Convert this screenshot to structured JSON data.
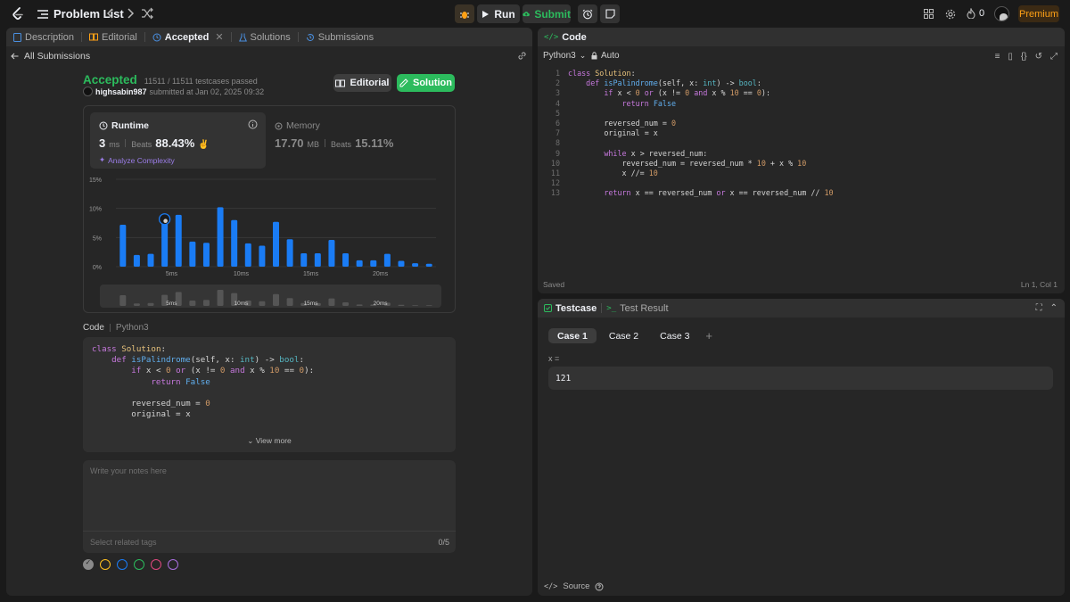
{
  "header": {
    "problem_list": "Problem List",
    "run": "Run",
    "submit": "Submit",
    "streak": "0",
    "premium": "Premium"
  },
  "left_tabs": [
    {
      "label": "Description",
      "icon": "document-icon"
    },
    {
      "label": "Editorial",
      "icon": "book-icon"
    },
    {
      "label": "Accepted",
      "icon": "clock-icon"
    },
    {
      "label": "Solutions",
      "icon": "flask-icon"
    },
    {
      "label": "Submissions",
      "icon": "history-icon"
    }
  ],
  "submission": {
    "back_label": "All Submissions",
    "status": "Accepted",
    "testcases": "11511 / 11511 testcases passed",
    "user": "highsabin987",
    "submitted_at": "submitted at Jan 02, 2025 09:32",
    "editorial_btn": "Editorial",
    "solution_btn": "Solution"
  },
  "runtime": {
    "label": "Runtime",
    "value": "3",
    "unit": "ms",
    "beats_label": "Beats",
    "beats": "88.43%",
    "analyze": "Analyze Complexity"
  },
  "memory": {
    "label": "Memory",
    "value": "17.70",
    "unit": "MB",
    "beats_label": "Beats",
    "beats": "15.11%"
  },
  "chart_data": {
    "type": "bar",
    "yticks": [
      "15%",
      "10%",
      "5%",
      "0%"
    ],
    "xticks": [
      "5ms",
      "10ms",
      "15ms",
      "20ms"
    ],
    "ylim": [
      0,
      15
    ],
    "values": [
      7.2,
      2.0,
      2.2,
      8.0,
      8.9,
      4.3,
      4.1,
      10.2,
      8.0,
      4.0,
      3.6,
      7.7,
      4.7,
      2.3,
      2.3,
      4.6,
      2.3,
      1.1,
      1.1,
      2.2,
      1.0,
      0.6,
      0.5
    ],
    "mini_values": [
      3.0,
      0.7,
      0.8,
      3.1,
      3.9,
      1.5,
      1.7,
      4.5,
      3.6,
      1.5,
      1.3,
      3.3,
      2.2,
      0.8,
      0.8,
      2.1,
      1.0,
      0.4,
      0.4,
      0.9,
      0.3,
      0.2,
      0.2
    ],
    "highlight_index": 3,
    "grid": true
  },
  "code_card": {
    "label": "Code",
    "lang": "Python3",
    "lines": [
      "class Solution:",
      "    def isPalindrome(self, x: int) -> bool:",
      "        if x < 0 or (x != 0 and x % 10 == 0):",
      "            return False",
      "",
      "        reversed_num = 0",
      "        original = x"
    ],
    "view_more": "View more"
  },
  "notes": {
    "placeholder": "Write your notes here",
    "tags_placeholder": "Select related tags",
    "count": "0/5"
  },
  "editor": {
    "title": "Code",
    "lang": "Python3",
    "auto": "Auto",
    "saved": "Saved",
    "cursor": "Ln 1, Col 1",
    "lines": [
      "class Solution:",
      "    def isPalindrome(self, x: int) -> bool:",
      "        if x < 0 or (x != 0 and x % 10 == 0):",
      "            return False",
      "",
      "        reversed_num = 0",
      "        original = x",
      "",
      "        while x > reversed_num:",
      "            reversed_num = reversed_num * 10 + x % 10",
      "            x //= 10",
      "",
      "        return x == reversed_num or x == reversed_num // 10"
    ]
  },
  "testcase": {
    "tab_label": "Testcase",
    "result_label": "Test Result",
    "cases": [
      "Case 1",
      "Case 2",
      "Case 3"
    ],
    "var_label": "x =",
    "value": "121",
    "source": "Source"
  },
  "colors": {
    "accent": "#2cbb5d",
    "bar": "#1a7cf5",
    "premium": "#ffa116"
  }
}
